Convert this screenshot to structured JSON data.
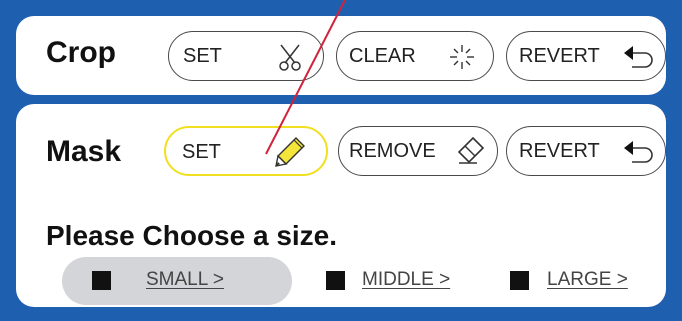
{
  "crop": {
    "title": "Crop",
    "buttons": [
      {
        "label": "SET",
        "icon": "scissors-icon"
      },
      {
        "label": "CLEAR",
        "icon": "sparkle-icon"
      },
      {
        "label": "REVERT",
        "icon": "undo-arrow-icon"
      }
    ]
  },
  "mask": {
    "title": "Mask",
    "buttons": [
      {
        "label": "SET",
        "icon": "pencil-icon",
        "active": true
      },
      {
        "label": "REMOVE",
        "icon": "eraser-icon"
      },
      {
        "label": "REVERT",
        "icon": "undo-arrow-icon"
      }
    ]
  },
  "size": {
    "prompt": "Please Choose a size.",
    "options": [
      {
        "label": "SMALL >",
        "selected": true
      },
      {
        "label": "MIDDLE >",
        "selected": false
      },
      {
        "label": "LARGE >",
        "selected": false
      }
    ]
  },
  "colors": {
    "frame": "#1f5fb0",
    "active_outline": "#f0e020",
    "pointer": "#d0223a",
    "selected_bg": "#d3d5d8"
  }
}
